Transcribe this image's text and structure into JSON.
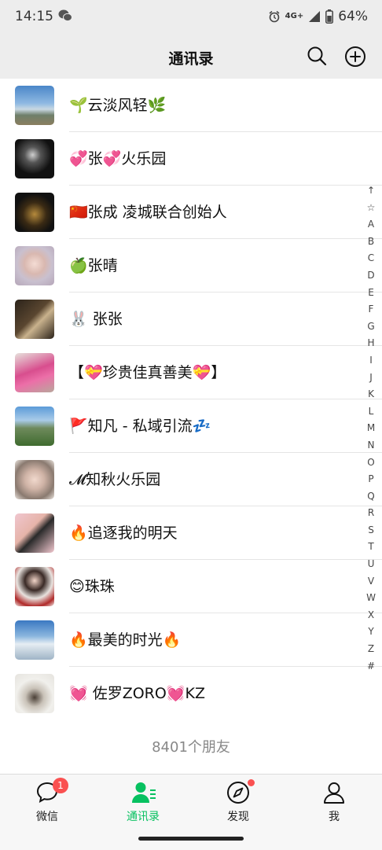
{
  "status": {
    "time": "14:15",
    "network": "4G+",
    "battery": "64%"
  },
  "header": {
    "title": "通讯录"
  },
  "contacts": [
    {
      "name": "🌱云淡风轻🌿"
    },
    {
      "name": "💞张💞火乐园"
    },
    {
      "name": "🇨🇳张成  凌城联合创始人"
    },
    {
      "name": "🍏张晴"
    },
    {
      "name": "🐰 张张"
    },
    {
      "name": "【💝珍贵佳真善美💝】"
    },
    {
      "name": "🚩知凡 - 私域引流💤"
    },
    {
      "name": "𝓜知秋火乐园"
    },
    {
      "name": "🔥追逐我的明天"
    },
    {
      "name": "😊珠珠"
    },
    {
      "name": "🔥最美的时光🔥"
    },
    {
      "name": "💓 佐罗ZORO💓KZ"
    }
  ],
  "index": [
    "↑",
    "☆",
    "A",
    "B",
    "C",
    "D",
    "E",
    "F",
    "G",
    "H",
    "I",
    "J",
    "K",
    "L",
    "M",
    "N",
    "O",
    "P",
    "Q",
    "R",
    "S",
    "T",
    "U",
    "V",
    "W",
    "X",
    "Y",
    "Z",
    "#"
  ],
  "footer": {
    "count": "8401个朋友"
  },
  "tabs": [
    {
      "label": "微信",
      "badge": "1"
    },
    {
      "label": "通讯录"
    },
    {
      "label": "发现"
    },
    {
      "label": "我"
    }
  ],
  "colors": {
    "accent": "#07c160",
    "badge": "#fa5151"
  }
}
